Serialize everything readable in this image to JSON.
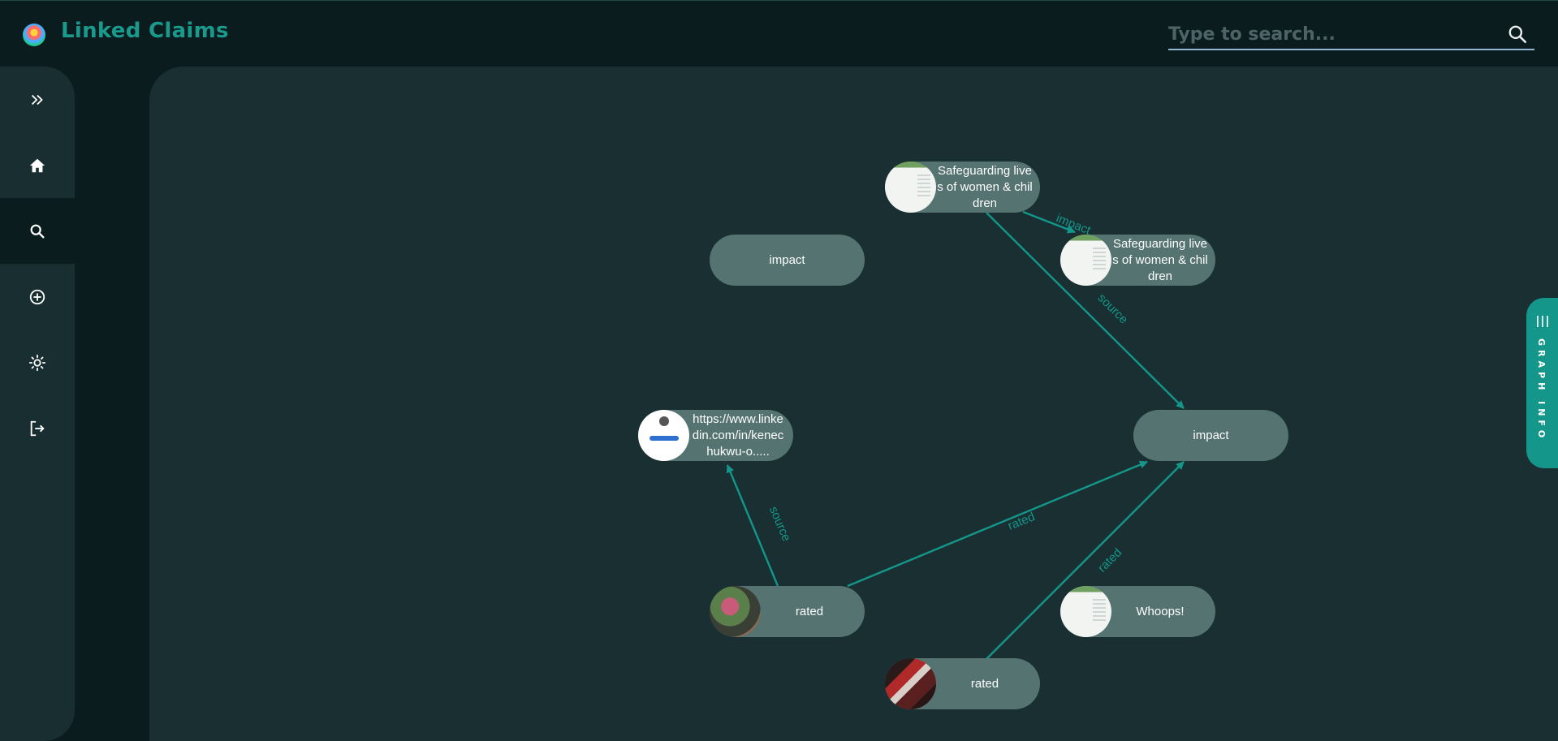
{
  "app": {
    "title": "Linked Claims"
  },
  "search": {
    "placeholder": "Type to search...",
    "value": ""
  },
  "sidebar": {
    "items": [
      {
        "name": "expand",
        "icon": "double-chevron-right-icon"
      },
      {
        "name": "home",
        "icon": "home-icon"
      },
      {
        "name": "search",
        "icon": "search-icon",
        "active": true
      },
      {
        "name": "add",
        "icon": "plus-circle-icon"
      },
      {
        "name": "theme",
        "icon": "sun-icon"
      },
      {
        "name": "logout",
        "icon": "logout-icon"
      }
    ]
  },
  "graph": {
    "nodes": [
      {
        "id": "n1",
        "label": "Safeguarding lives of women & children",
        "thumb": "doc"
      },
      {
        "id": "n2",
        "label": "Safeguarding lives of women & children",
        "thumb": "doc"
      },
      {
        "id": "n3",
        "label": "impact",
        "thumb": null
      },
      {
        "id": "n4",
        "label": "impact",
        "thumb": null
      },
      {
        "id": "n5",
        "label": "https://www.linkedin.com/in/kenechukwu-o.....",
        "thumb": "profile"
      },
      {
        "id": "n6",
        "label": "rated",
        "thumb": "photo1"
      },
      {
        "id": "n7",
        "label": "Whoops!",
        "thumb": "doc"
      },
      {
        "id": "n8",
        "label": "rated",
        "thumb": "photo2"
      }
    ],
    "edges": [
      {
        "from": "n1",
        "to": "n2",
        "label": "impact"
      },
      {
        "from": "n1",
        "to": "n4",
        "label": "source"
      },
      {
        "from": "n6",
        "to": "n5",
        "label": "source"
      },
      {
        "from": "n6",
        "to": "n4",
        "label": "rated"
      },
      {
        "from": "n8",
        "to": "n4",
        "label": "rated"
      }
    ]
  },
  "graph_info_tab": {
    "label": "GRAPH INFO"
  },
  "colors": {
    "accent": "#14968a",
    "node": "#547371",
    "canvas": "#192f31",
    "background": "#0b1c1f"
  }
}
